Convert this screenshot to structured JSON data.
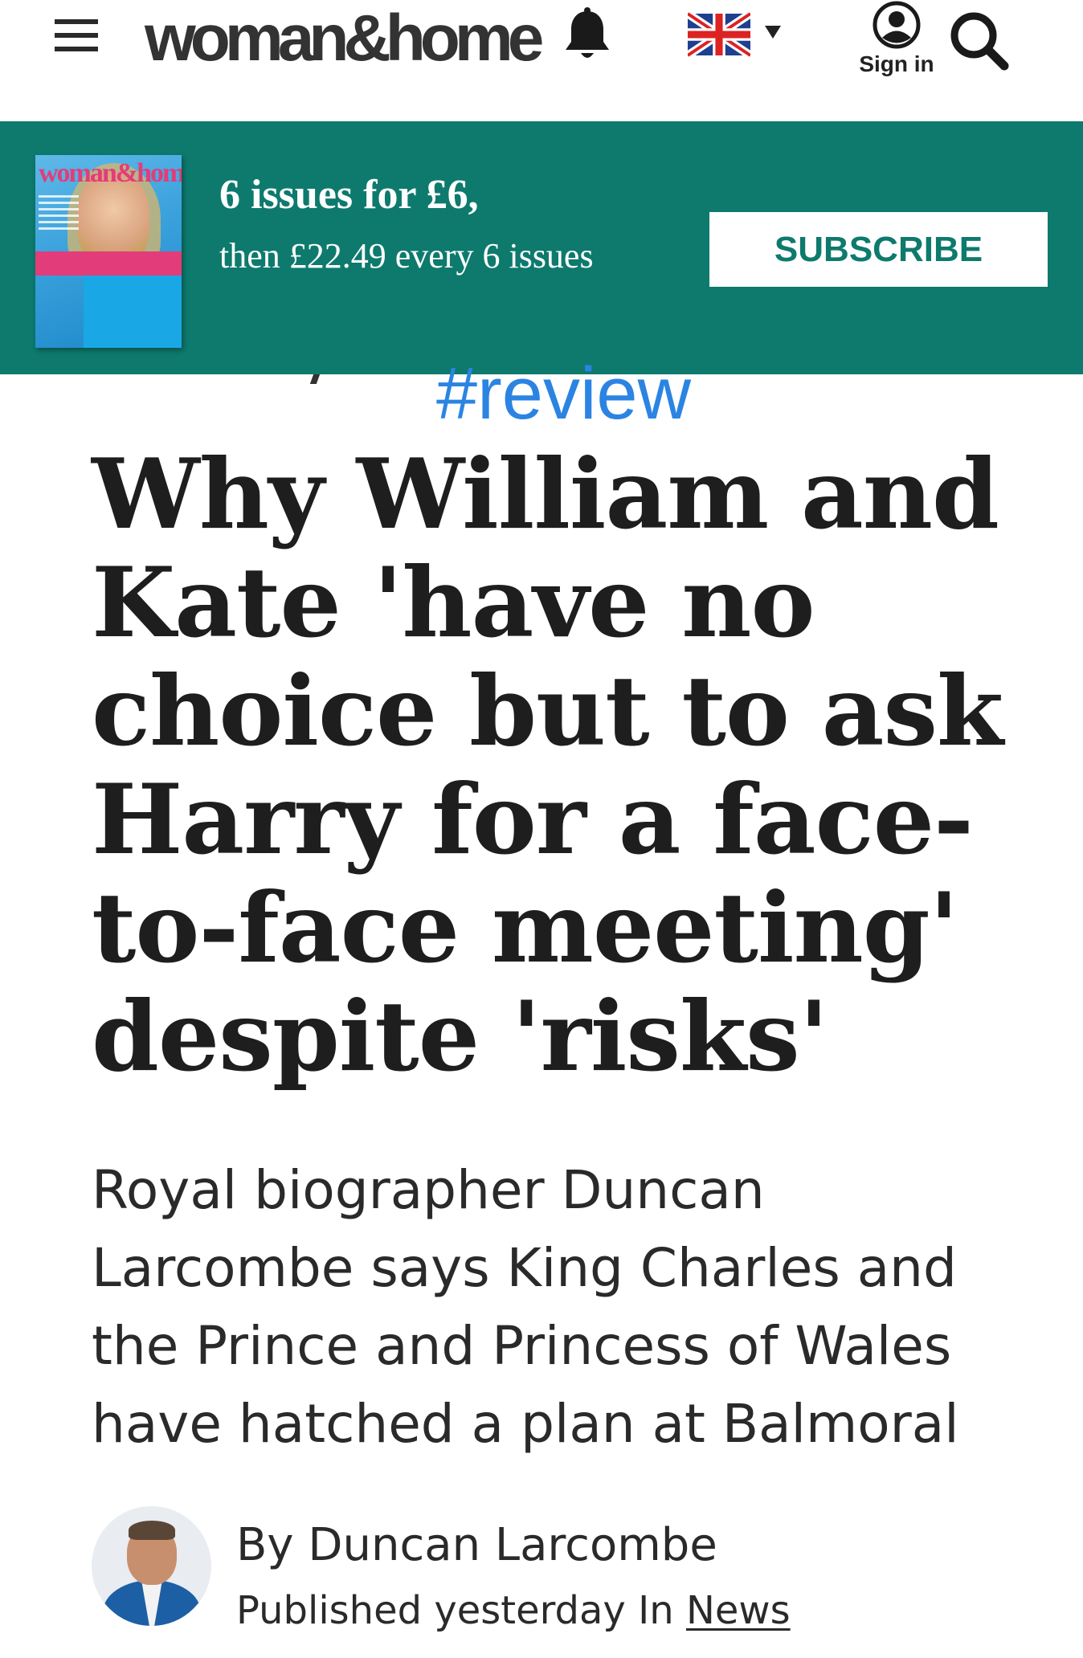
{
  "header": {
    "logo_text": "woman&home",
    "sign_in_label": "Sign in",
    "icons": [
      "menu-icon",
      "bell-icon",
      "uk-flag-icon",
      "caret-down-icon",
      "user-icon",
      "search-icon"
    ]
  },
  "banner": {
    "offer_headline": "6 issues for £6,",
    "offer_detail": "then £22.49 every 6 issues",
    "subscribe_label": "SUBSCRIBE",
    "magazine_mast": "woman&home",
    "colors": {
      "background": "#0d7a6d",
      "button_text": "#0d7a6d"
    }
  },
  "overlay": {
    "hashtag": "#review",
    "color": "#2b84e2"
  },
  "article": {
    "headline": "Why William and Kate 'have no choice but to ask Harry for a face-to-face meeting' despite 'risks'",
    "standfirst": "Royal biographer Duncan Larcombe says King Charles and the Prince and Princess of Wales have hatched a plan at Balmoral",
    "byline": {
      "author": "By Duncan Larcombe",
      "published_prefix": "Published yesterday In",
      "section_link": "News"
    }
  }
}
